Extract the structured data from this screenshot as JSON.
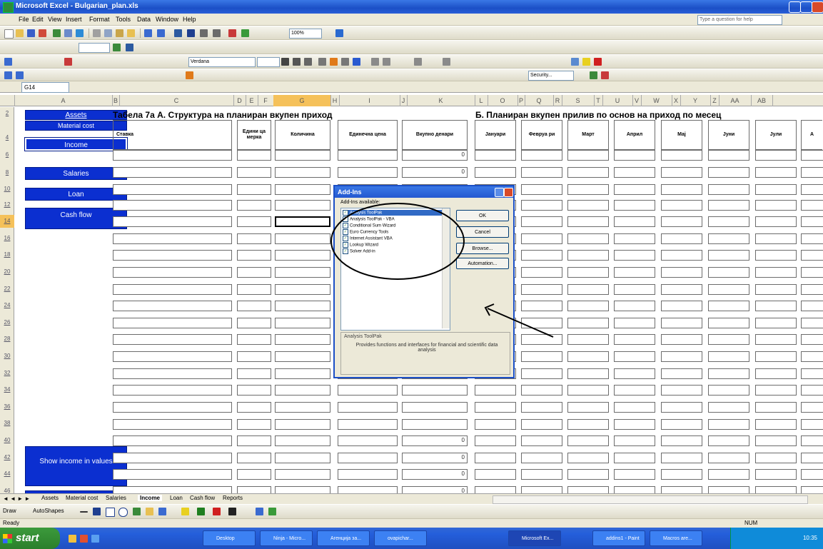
{
  "window": {
    "title": "Microsoft Excel - Bulgarian_plan.xls"
  },
  "menubar": {
    "items": [
      "File",
      "Edit",
      "View",
      "Insert",
      "Format",
      "Tools",
      "Data",
      "Window",
      "Help"
    ],
    "ask_placeholder": "Type a question for help"
  },
  "toolbars": {
    "zoom": "100%",
    "font": "Verdana",
    "security_label": "Security..."
  },
  "formula_bar": {
    "name_box": "G14"
  },
  "columns": [
    "A",
    "B",
    "C",
    "D",
    "E",
    "F",
    "G",
    "H",
    "I",
    "J",
    "K",
    "L",
    "O",
    "P",
    "Q",
    "R",
    "S",
    "T",
    "U",
    "V",
    "W",
    "X",
    "Y",
    "Z",
    "AA",
    "AB"
  ],
  "rows": [
    "2",
    "4",
    "6",
    "8",
    "10",
    "12",
    "14",
    "16",
    "18",
    "20",
    "22",
    "24",
    "26",
    "28",
    "30",
    "32",
    "34",
    "36",
    "38",
    "40",
    "42",
    "44",
    "46"
  ],
  "nav_buttons": {
    "assets": "Assets",
    "material_cost": "Material cost",
    "income": "Income",
    "salaries": "Salaries",
    "loan": "Loan",
    "cash_flow": "Cash flow",
    "show_income": "Show income in values"
  },
  "sheet": {
    "table_a_title": "Табела 7а А. Структура на планиран вкупен приход",
    "table_b_title": "Б. Планиран вкупен прилив по основ на приход по месец",
    "headers": {
      "stavka": "Ставка",
      "unit": "Едини ца мерка",
      "qty": "Количина",
      "unit_price": "Единечна цена",
      "total": "Вкупно денари",
      "months": [
        "Јануари",
        "Февруа ри",
        "Март",
        "Април",
        "Мај",
        "Јуни",
        "Јули",
        "А"
      ]
    },
    "zero_value": "0"
  },
  "dialog": {
    "title": "Add-Ins",
    "list_label": "Add-Ins available:",
    "items": [
      {
        "label": "Analysis ToolPak",
        "checked": true
      },
      {
        "label": "Analysis ToolPak - VBA",
        "checked": true
      },
      {
        "label": "Conditional Sum Wizard",
        "checked": true
      },
      {
        "label": "Euro Currency Tools",
        "checked": true
      },
      {
        "label": "Internet Assistant VBA",
        "checked": true
      },
      {
        "label": "Lookup Wizard",
        "checked": true
      },
      {
        "label": "Solver Add-in",
        "checked": true
      }
    ],
    "buttons": {
      "ok": "OK",
      "cancel": "Cancel",
      "browse": "Browse...",
      "automation": "Automation..."
    },
    "desc_title": "Analysis ToolPak",
    "desc_text": "Provides functions and interfaces for financial and scientific data analysis"
  },
  "sheet_tabs": [
    "Assets",
    "Material cost",
    "Salaries",
    "Income",
    "Loan",
    "Cash flow",
    "Reports"
  ],
  "active_tab": "Income",
  "drawing_toolbar": {
    "draw": "Draw",
    "autoshapes": "AutoShapes"
  },
  "status": {
    "left": "Ready",
    "right": "NUM"
  },
  "taskbar": {
    "start": "start",
    "tasks": [
      "Desktop",
      "Ninja - Micro...",
      "Агенција за...",
      "ovapichar...",
      "Microsoft Ex...",
      "addins1 - Paint",
      "Macros are..."
    ],
    "clock": "10:35"
  }
}
